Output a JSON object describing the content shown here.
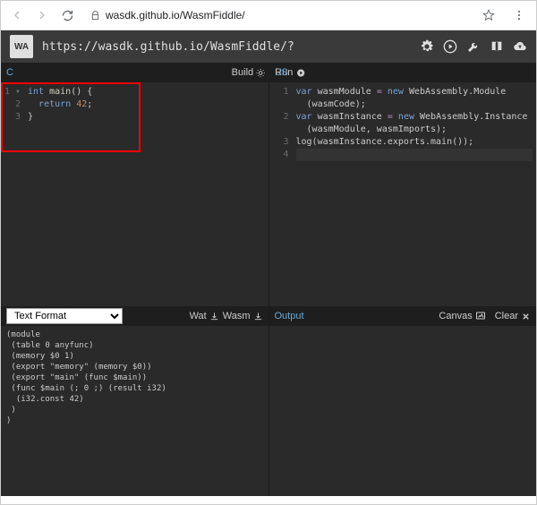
{
  "browser": {
    "url": "wasdk.github.io/WasmFiddle/"
  },
  "header": {
    "logo": "WA",
    "url": "https://wasdk.github.io/WasmFiddle/?"
  },
  "toolbar": {
    "c_label": "C",
    "build_label": "Build",
    "run_label": "Run",
    "js_label": "JS"
  },
  "c_editor": {
    "lines": [
      {
        "n": "1 ▾",
        "html": "<span class='kw'>int</span> <span class='fn'>main</span>() {"
      },
      {
        "n": "2",
        "html": "  <span class='kw'>return</span> <span class='num'>42</span>;"
      },
      {
        "n": "3",
        "html": "}"
      }
    ]
  },
  "js_editor": {
    "lines": [
      {
        "n": "1",
        "html": "<span class='kw'>var</span> wasmModule <span class='op'>=</span> <span class='kw'>new</span> WebAssembly.Module"
      },
      {
        "n": "",
        "html": "  (wasmCode);"
      },
      {
        "n": "2",
        "html": "<span class='kw'>var</span> wasmInstance <span class='op'>=</span> <span class='kw'>new</span> WebAssembly.Instance"
      },
      {
        "n": "",
        "html": "  (wasmModule, wasmImports);"
      },
      {
        "n": "3",
        "html": "log(wasmInstance.exports.main());"
      },
      {
        "n": "4",
        "html": "",
        "cursor": true
      }
    ]
  },
  "mid": {
    "select_label": "Text Format",
    "wat_label": "Wat",
    "wasm_label": "Wasm",
    "output_label": "Output",
    "canvas_label": "Canvas",
    "clear_label": "Clear"
  },
  "wat_output": {
    "lines": [
      "(module",
      " (table 0 anyfunc)",
      " (memory $0 1)",
      " (export \"memory\" (memory $0))",
      " (export \"main\" (func $main))",
      " (func $main (; 0 ;) (result i32)",
      "  (i32.const 42)",
      " )",
      ")"
    ]
  }
}
